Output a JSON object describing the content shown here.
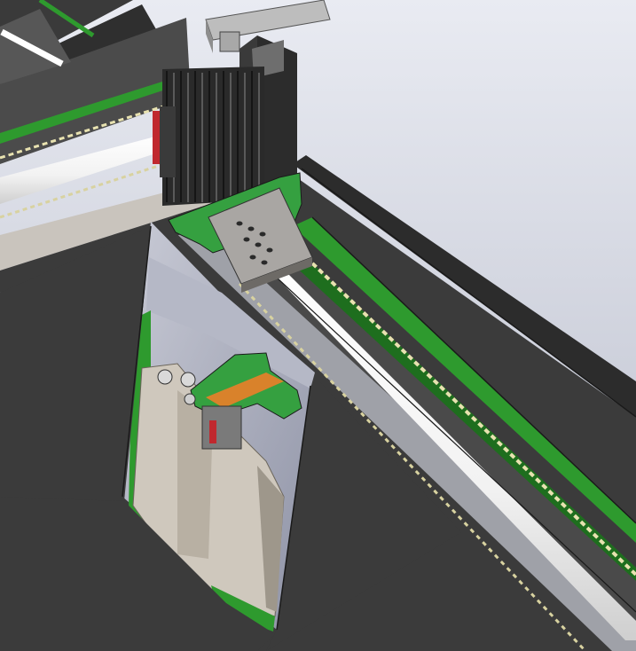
{
  "scene": {
    "kind": "cad-render",
    "subject": "",
    "colors": {
      "background_top": "#e9ebf2",
      "background_bottom": "#b9bdcb",
      "frame_dark": "#3b3b3b",
      "frame_darker": "#2c2c2c",
      "frame_edge": "#1a1a1a",
      "rail_green": "#2e9a2e",
      "rail_green_dark": "#1e6e1e",
      "rod_white": "#fafafa",
      "rail_bead": "#e8e2b0",
      "plate_gray": "#a9a6a3",
      "bellows_dark": "#2a2a2a",
      "bracket_green": "#35a040",
      "carriage_orange": "#d9822b",
      "housing_beige": "#cfc8bd",
      "housing_shadow": "#9e978b",
      "cutout_gray": "#9aa0b4",
      "top_bracket": "#bdbdbd",
      "red_accent": "#c0282e"
    }
  }
}
